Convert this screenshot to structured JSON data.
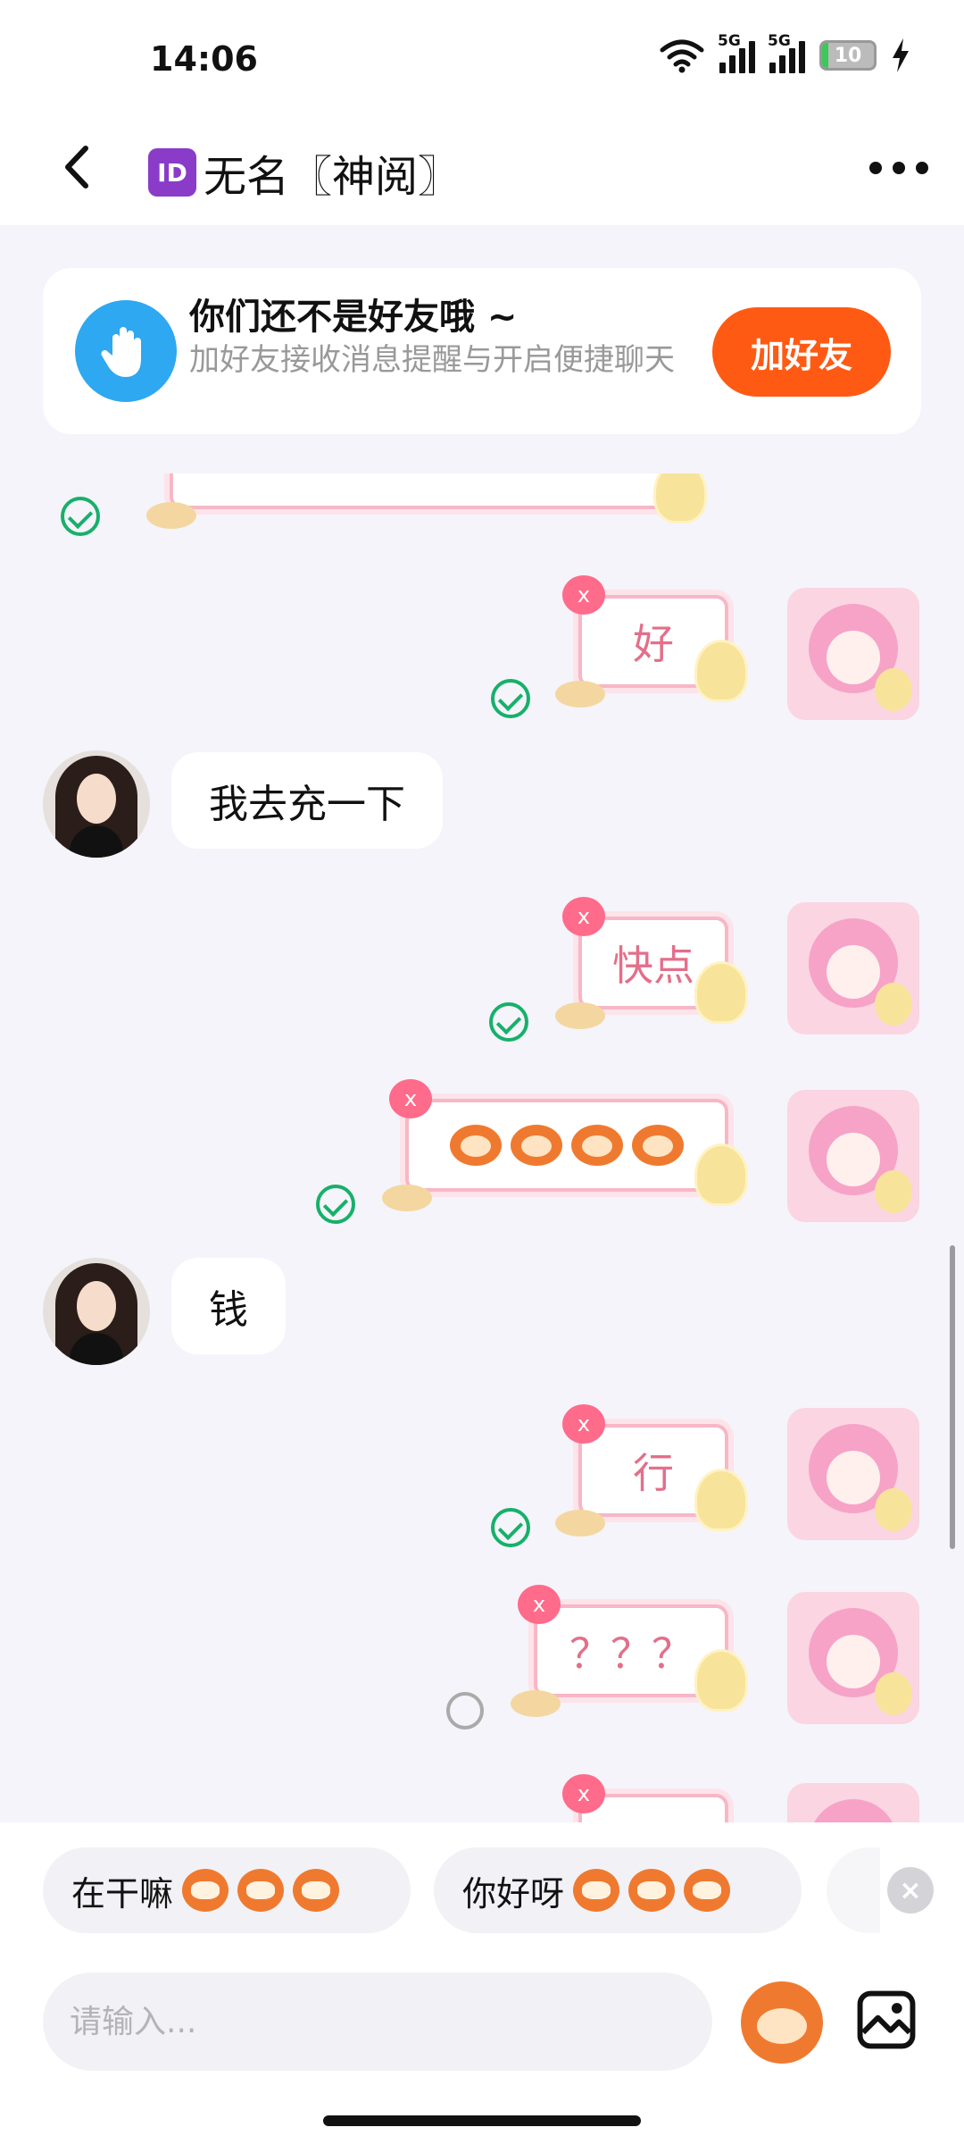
{
  "status_bar": {
    "time": "14:06",
    "network_label": "5G",
    "battery_level": "10"
  },
  "header": {
    "badge": "ID",
    "title": "无名〖神阅〗"
  },
  "friend_prompt": {
    "title": "你们还不是好友哦 ~",
    "description": "加好友接收消息提醒与开启便捷聊天",
    "add_label": "加好友"
  },
  "messages": [
    {
      "from": "me",
      "type": "sticker",
      "text": "",
      "status": "sent"
    },
    {
      "from": "me",
      "type": "sticker",
      "text": "好",
      "status": "sent"
    },
    {
      "from": "peer",
      "type": "text",
      "text": "我去充一下"
    },
    {
      "from": "me",
      "type": "sticker",
      "text": "快点",
      "status": "sent"
    },
    {
      "from": "me",
      "type": "sticker",
      "text": "",
      "status": "sent",
      "emoji": "monkey-faces"
    },
    {
      "from": "peer",
      "type": "text",
      "text": "钱"
    },
    {
      "from": "me",
      "type": "sticker",
      "text": "行",
      "status": "sent"
    },
    {
      "from": "me",
      "type": "sticker",
      "text": "？？？",
      "status": "pending"
    },
    {
      "from": "me",
      "type": "sticker",
      "text": "",
      "status": "partial"
    }
  ],
  "quick_replies": [
    {
      "label": "在干嘛",
      "emoji": "grinning-monkey"
    },
    {
      "label": "你好呀",
      "emoji": "wide-eyed-monkey"
    }
  ],
  "composer": {
    "placeholder": "请输入..."
  },
  "colors": {
    "accent": "#ff5a14",
    "sent_check": "#17b06a",
    "info_icon": "#2ea8f0",
    "sticker_text": "#e36f8a"
  }
}
